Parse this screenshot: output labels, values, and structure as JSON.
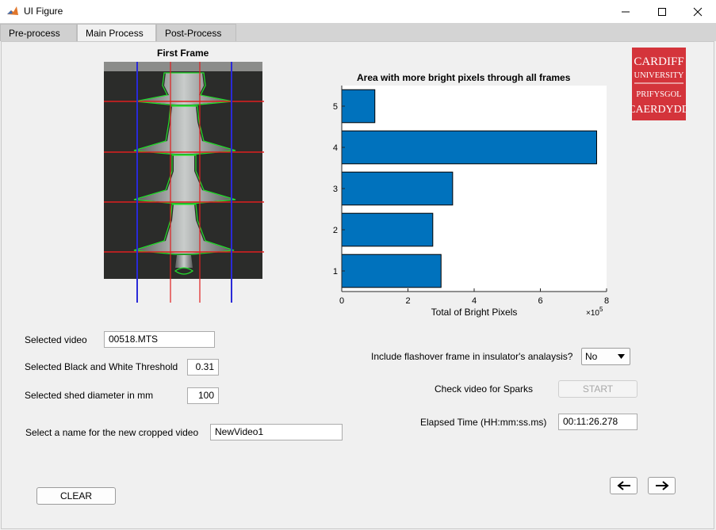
{
  "window": {
    "title": "UI Figure"
  },
  "tabs": [
    {
      "label": "Pre-process"
    },
    {
      "label": "Main Process"
    },
    {
      "label": "Post-Process"
    }
  ],
  "image_panel": {
    "title": "First Frame"
  },
  "chart": {
    "title": "Area with more bright pixels through all frames"
  },
  "chart_data": {
    "type": "bar",
    "orientation": "horizontal",
    "title": "Area with more bright pixels through all frames",
    "xlabel": "Total of Bright Pixels",
    "ylabel": "",
    "x_exponent_label": "×10",
    "x_exponent_power": "5",
    "categories": [
      "1",
      "2",
      "3",
      "4",
      "5"
    ],
    "values": [
      300000,
      275000,
      335000,
      770000,
      100000
    ],
    "xlim": [
      0,
      800000
    ],
    "xticks": [
      "0",
      "2",
      "4",
      "6",
      "8"
    ],
    "bar_color": "#0072bd",
    "grid": false
  },
  "form": {
    "selected_video_label": "Selected video",
    "selected_video_value": "00518.MTS",
    "threshold_label": "Selected Black and White Threshold",
    "threshold_value": "0.31",
    "shed_label": "Selected shed diameter in mm",
    "shed_value": "100",
    "name_label": "Select a name for the new cropped video",
    "name_value": "NewVideo1",
    "flashover_label": "Include flashover frame in insulator's analaysis?",
    "flashover_value": "No",
    "sparks_label": "Check video for Sparks",
    "start_label": "START",
    "elapsed_label": "Elapsed Time (HH:mm:ss.ms)",
    "elapsed_value": "00:11:26.278",
    "clear_label": "CLEAR"
  },
  "logo": {
    "line1": "CARDIFF",
    "line2": "UNIVERSITY",
    "line3": "PRIFYSGOL",
    "line4": "CAERDYDD",
    "color": "#d4343b"
  },
  "nav": {
    "back_icon": "arrow-left-icon",
    "forward_icon": "arrow-right-icon"
  }
}
